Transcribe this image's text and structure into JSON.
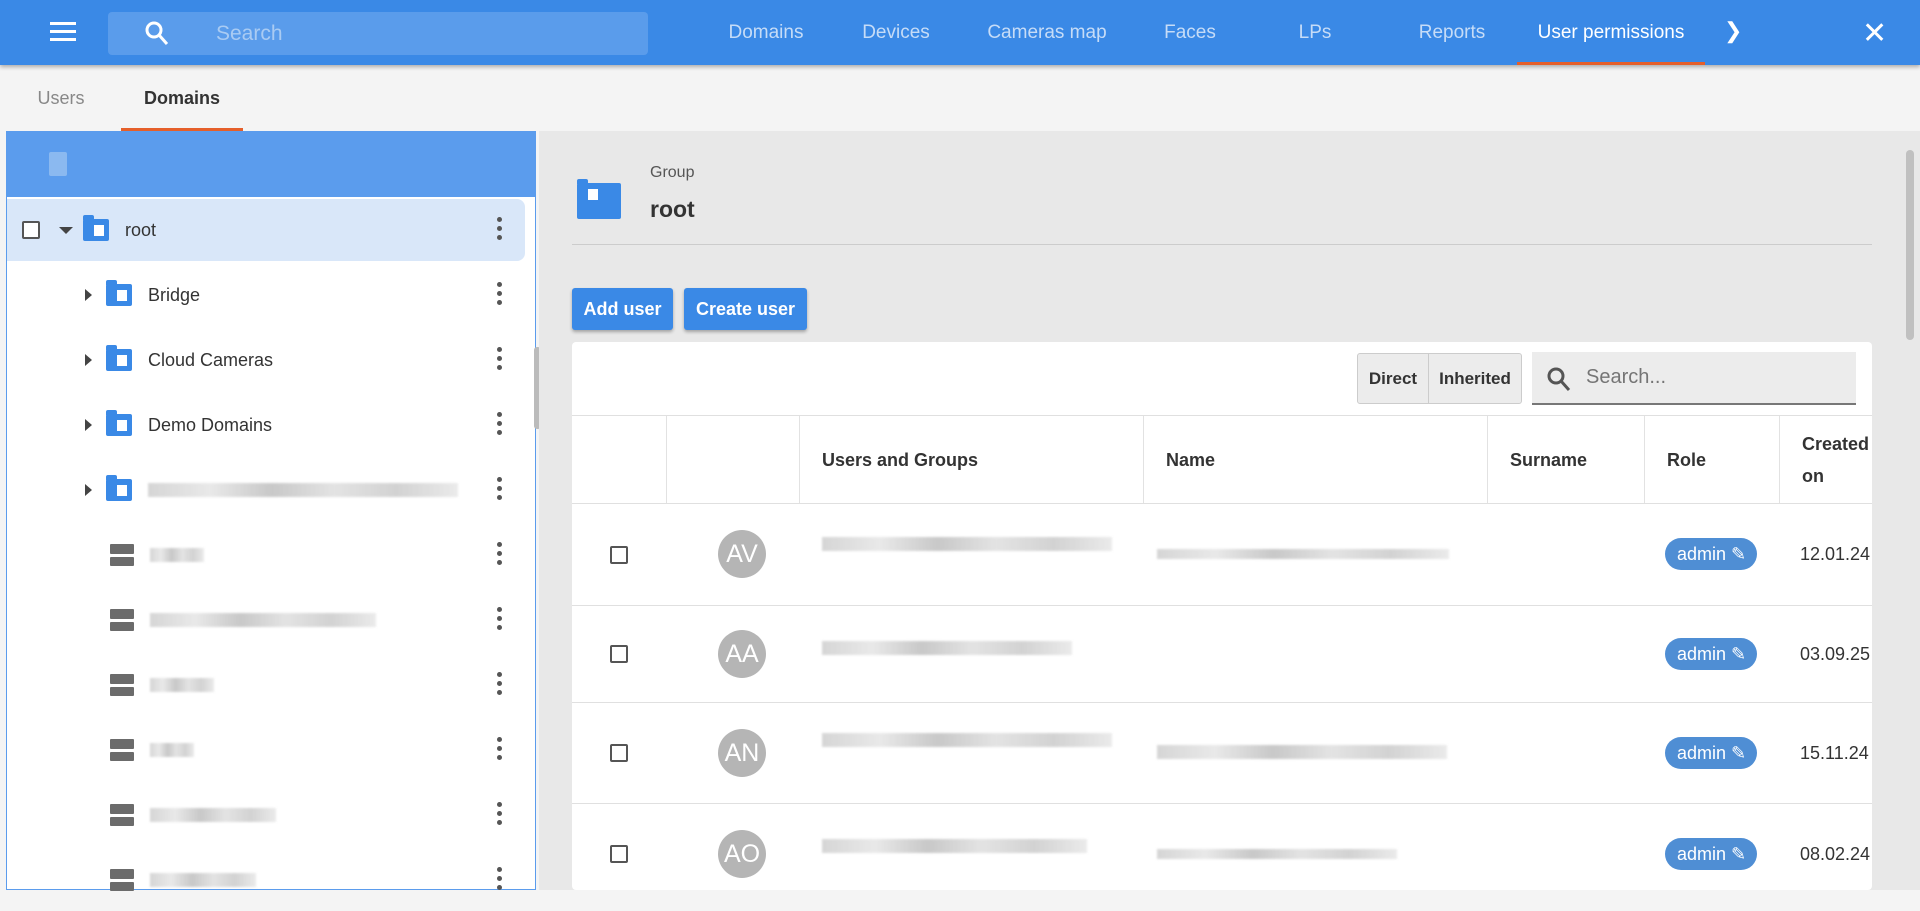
{
  "header": {
    "search_placeholder": "Search",
    "nav": [
      "Domains",
      "Devices",
      "Cameras map",
      "Faces",
      "LPs",
      "Reports",
      "User permissions"
    ],
    "active_nav": "User permissions"
  },
  "subtabs": [
    "Users",
    "Domains"
  ],
  "tree": {
    "items": [
      {
        "label": "root",
        "type": "folder"
      },
      {
        "label": "Bridge",
        "type": "folder"
      },
      {
        "label": "Cloud Cameras",
        "type": "folder"
      },
      {
        "label": "Demo Domains",
        "type": "folder"
      }
    ]
  },
  "group": {
    "caption": "Group",
    "name": "root"
  },
  "buttons": {
    "add_user": "Add user",
    "create_user": "Create user"
  },
  "filter": {
    "direct": "Direct",
    "inherited": "Inherited",
    "search_placeholder": "Search..."
  },
  "table": {
    "headers": [
      "Users and Groups",
      "Name",
      "Surname",
      "Role",
      "Created on"
    ],
    "rows": [
      {
        "initials": "AV",
        "role": "admin",
        "created": "12.01.24"
      },
      {
        "initials": "AA",
        "role": "admin",
        "created": "03.09.25"
      },
      {
        "initials": "AN",
        "role": "admin",
        "created": "15.11.24"
      },
      {
        "initials": "AO",
        "role": "admin",
        "created": "08.02.24"
      }
    ]
  },
  "colors": {
    "primary": "#3a89e6",
    "accent": "#e55f2a"
  }
}
